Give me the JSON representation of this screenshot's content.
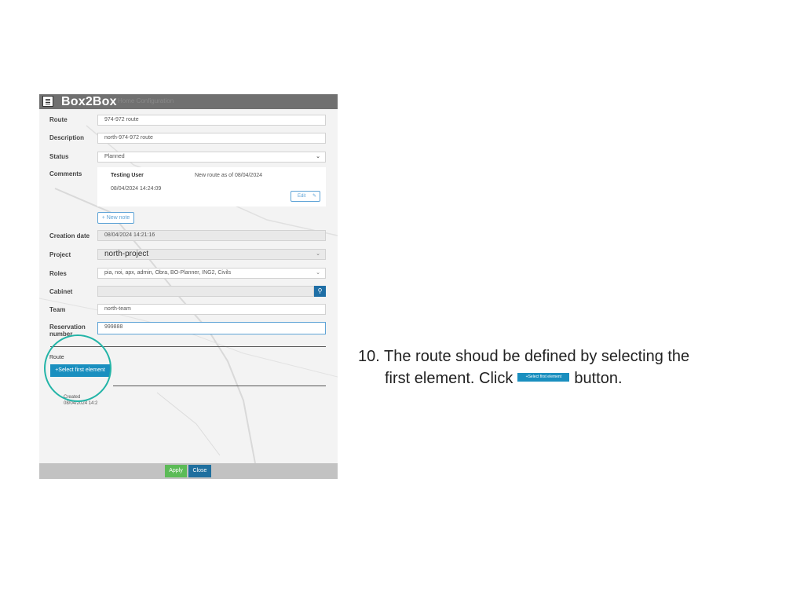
{
  "app": {
    "title": "Box2Box",
    "ghost_menu": "Home   Configuration"
  },
  "form": {
    "route_label": "Route",
    "route_value": "974-972 route",
    "description_label": "Description",
    "description_value": "north-974-972 route",
    "status_label": "Status",
    "status_value": "Planned",
    "comments_label": "Comments",
    "comment": {
      "user": "Testing User",
      "text": "New route as of 08/04/2024",
      "date": "08/04/2024 14:24:09",
      "edit_label": "Edit"
    },
    "new_note_label": "+ New note",
    "creation_date_label": "Creation date",
    "creation_date_value": "08/04/2024 14:21:16",
    "project_label": "Project",
    "project_value": "north-project",
    "roles_label": "Roles",
    "roles_value": "pia, noi, apx, admin, Obra, BO-Planner, ING2, Civils",
    "cabinet_label": "Cabinet",
    "cabinet_value": "",
    "team_label": "Team",
    "team_value": "north-team",
    "reservation_label_1": "Reservation",
    "reservation_label_2": "number",
    "reservation_value": "999888",
    "route_section_label": "Route",
    "select_first_label": "+Select first element",
    "created_label": "Created",
    "created_value": "08/04/2024 14:2"
  },
  "footer": {
    "apply_label": "Apply",
    "close_label": "Close"
  },
  "instruction": {
    "number": "10.",
    "line1": "The route shoud be defined by selecting the",
    "line2_a": "first element. Click",
    "button_label": "+Select first element",
    "line2_b": "button."
  },
  "icons": {
    "app": "list-icon",
    "search": "search-icon",
    "edit": "pencil-icon",
    "dropdown": "chevron-down-icon"
  },
  "colors": {
    "accent": "#1a8fbf",
    "apply": "#5cbb57",
    "close": "#1f6f9e",
    "highlight": "#23b4a7"
  }
}
